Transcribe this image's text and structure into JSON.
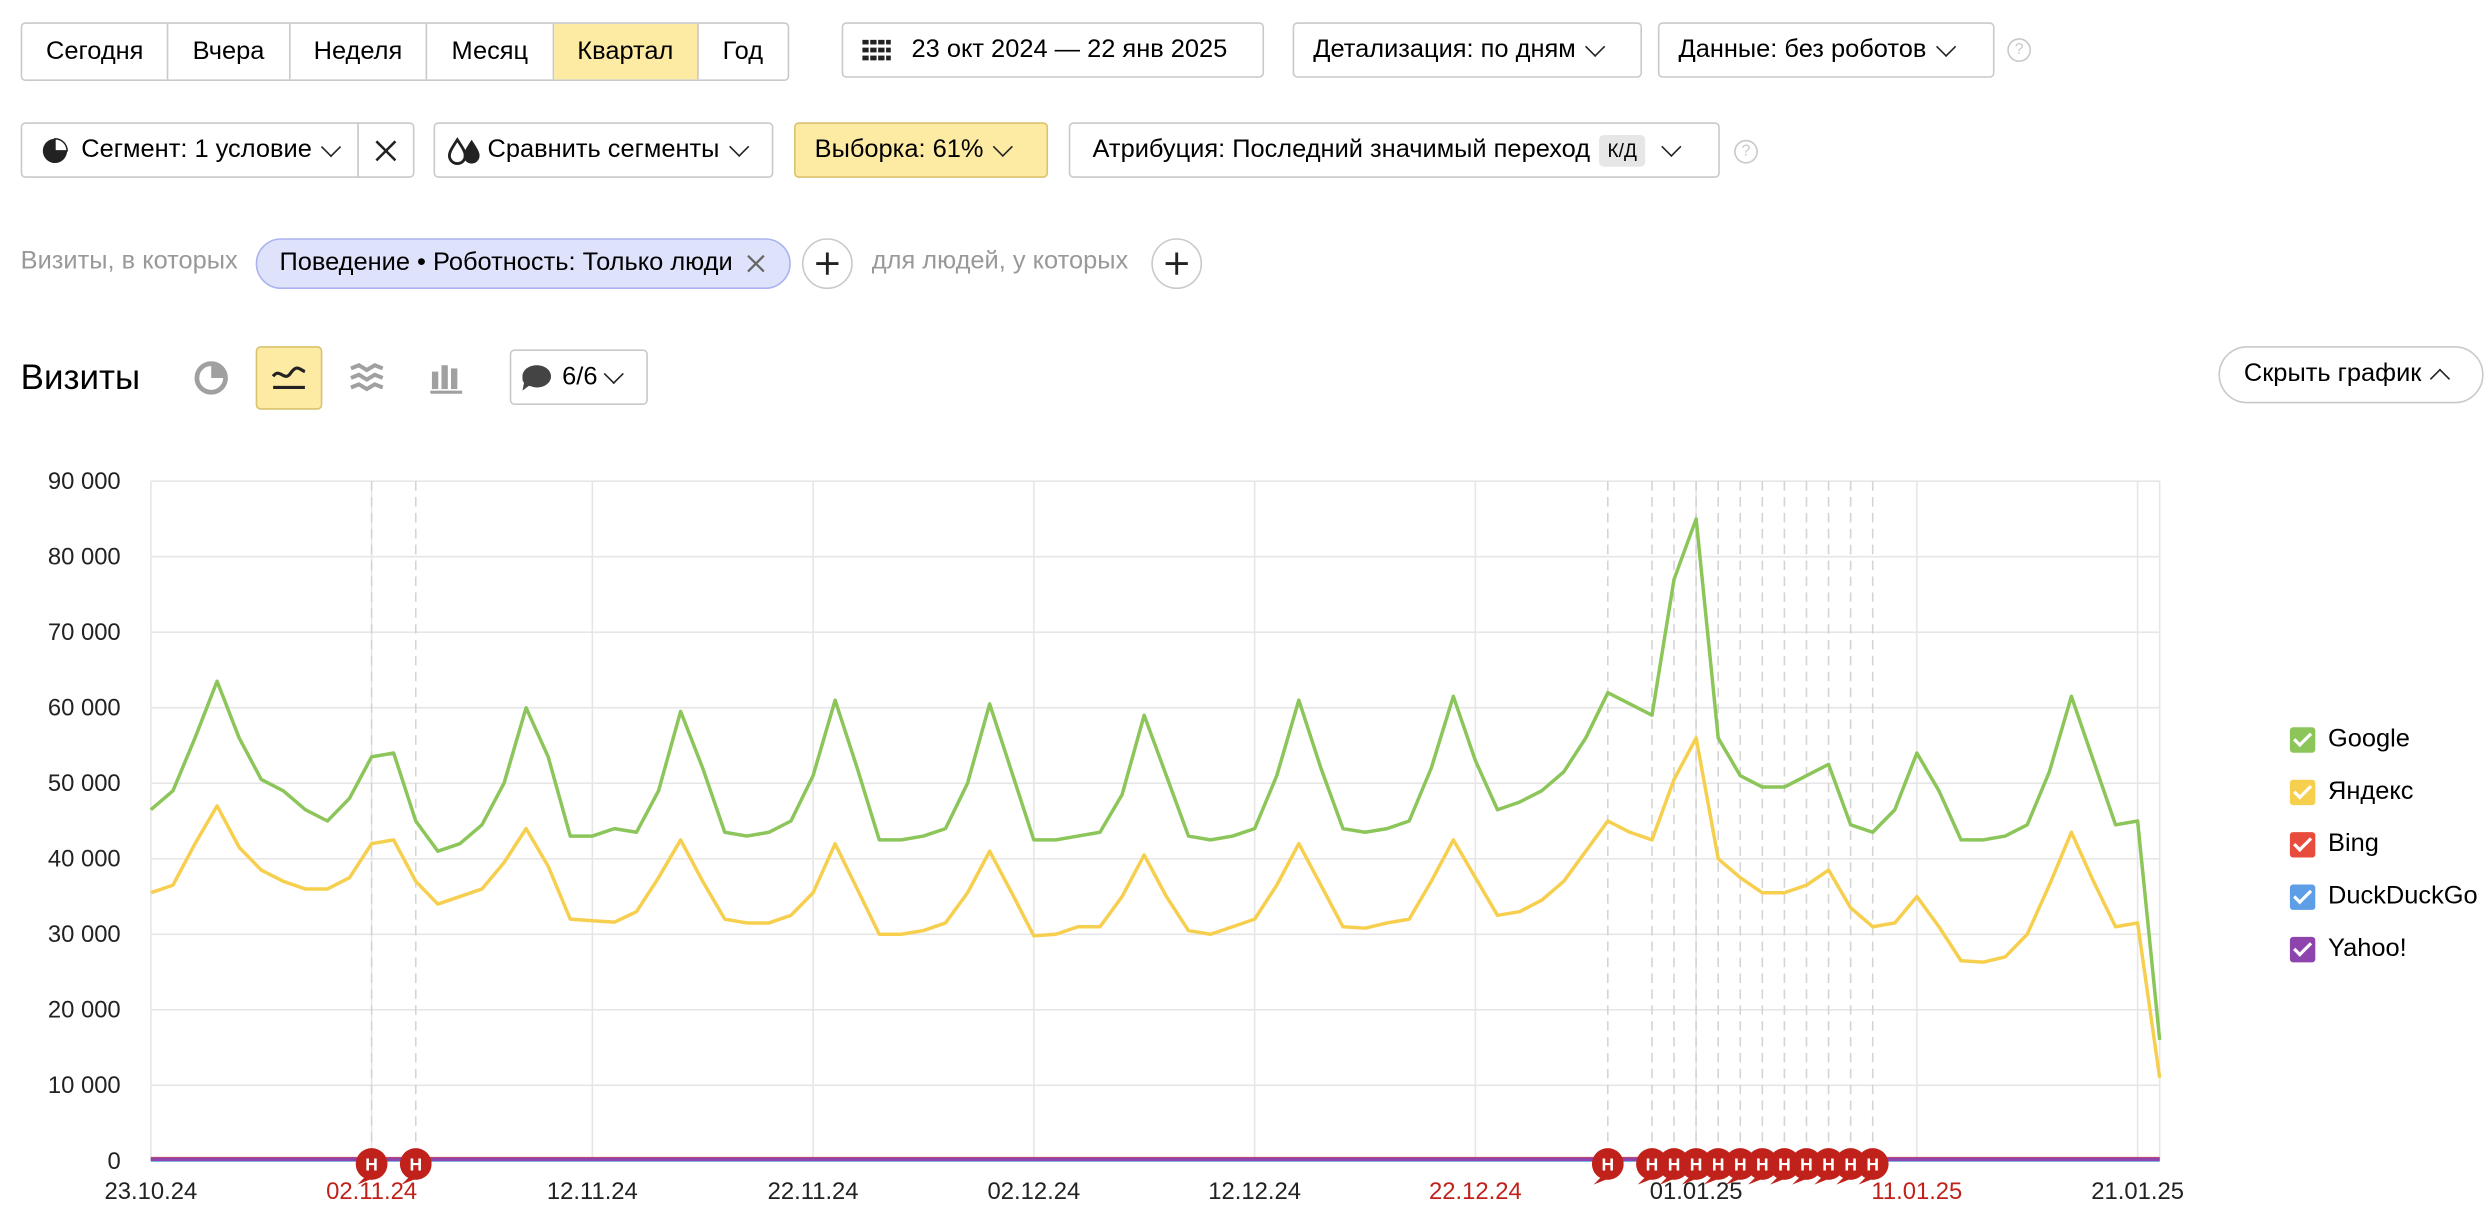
{
  "period_tabs": [
    "Сегодня",
    "Вчера",
    "Неделя",
    "Месяц",
    "Квартал",
    "Год"
  ],
  "period_active": "Квартал",
  "date_range": "23 окт 2024 — 22 янв 2025",
  "detail_label": "Детализация: по дням",
  "data_label": "Данные: без роботов",
  "help_glyph": "?",
  "segment_label": "Сегмент: 1 условие",
  "compare_label": "Сравнить сегменты",
  "sample_label": "Выборка: 61%",
  "attribution_label": "Атрибуция: Последний значимый переход",
  "attribution_badge": "К/Д",
  "filter_prefix": "Визиты, в которых",
  "filter_chip": "Поведение • Роботность: Только люди",
  "filter_people": "для людей, у которых",
  "visits_title": "Визиты",
  "annotations_count": "6/6",
  "hide_chart_label": "Скрыть график",
  "colors": {
    "accent_yellow": "#fdeaa3",
    "google": "#8cc65a",
    "yandex": "#f7cf4e",
    "bing": "#e84c3d",
    "duckduckgo": "#5d9ee6",
    "yahoo": "#8e44ad",
    "holiday": "#c0221b"
  },
  "chart_data": {
    "type": "line",
    "x_start": "2024-10-23",
    "x_end": "2025-01-22",
    "x_ticks": [
      {
        "date": "2024-10-23",
        "label": "23.10.24",
        "holiday": false
      },
      {
        "date": "2024-11-02",
        "label": "02.11.24",
        "holiday": true
      },
      {
        "date": "2024-11-12",
        "label": "12.11.24",
        "holiday": false
      },
      {
        "date": "2024-11-22",
        "label": "22.11.24",
        "holiday": false
      },
      {
        "date": "2024-12-02",
        "label": "02.12.24",
        "holiday": false
      },
      {
        "date": "2024-12-12",
        "label": "12.12.24",
        "holiday": false
      },
      {
        "date": "2024-12-22",
        "label": "22.12.24",
        "holiday": true
      },
      {
        "date": "2025-01-01",
        "label": "01.01.25",
        "holiday": false
      },
      {
        "date": "2025-01-11",
        "label": "11.01.25",
        "holiday": true
      },
      {
        "date": "2025-01-21",
        "label": "21.01.25",
        "holiday": false
      }
    ],
    "y_ticks": [
      {
        "value": 0,
        "label": "0"
      },
      {
        "value": 10000,
        "label": "10 000"
      },
      {
        "value": 20000,
        "label": "20 000"
      },
      {
        "value": 30000,
        "label": "30 000"
      },
      {
        "value": 40000,
        "label": "40 000"
      },
      {
        "value": 50000,
        "label": "50 000"
      },
      {
        "value": 60000,
        "label": "60 000"
      },
      {
        "value": 70000,
        "label": "70 000"
      },
      {
        "value": 80000,
        "label": "80 000"
      },
      {
        "value": 90000,
        "label": "90 000"
      }
    ],
    "ylim": [
      0,
      90000
    ],
    "grid": true,
    "legend_position": "right",
    "holiday_marker_label": "Н",
    "holiday_dates": [
      "2024-11-02",
      "2024-11-04",
      "2024-12-28",
      "2024-12-30",
      "2024-12-31",
      "2025-01-01",
      "2025-01-02",
      "2025-01-03",
      "2025-01-04",
      "2025-01-05",
      "2025-01-06",
      "2025-01-07",
      "2025-01-08",
      "2025-01-09"
    ],
    "series": [
      {
        "name": "Google",
        "color": "#8cc65a",
        "values": [
          46500,
          49000,
          56000,
          63500,
          56000,
          50500,
          49000,
          46500,
          45000,
          48000,
          53500,
          54000,
          45000,
          41000,
          42000,
          44500,
          50000,
          60000,
          53500,
          43000,
          43000,
          44000,
          43500,
          49000,
          59500,
          52000,
          43500,
          43000,
          43500,
          45000,
          51000,
          61000,
          52000,
          42500,
          42500,
          43000,
          44000,
          50000,
          60500,
          51500,
          42500,
          42500,
          43000,
          43500,
          48500,
          59000,
          51000,
          43000,
          42500,
          43000,
          44000,
          51000,
          61000,
          52000,
          44000,
          43500,
          44000,
          45000,
          52000,
          61500,
          53000,
          46500,
          47500,
          49000,
          51500,
          56000,
          62000,
          60500,
          59000,
          77000,
          85000,
          56000,
          51000,
          49500,
          49500,
          51000,
          52500,
          44500,
          43500,
          46500,
          54000,
          49000,
          42500,
          42500,
          43000,
          44500,
          51500,
          61500,
          53000,
          44500,
          45000,
          16000
        ]
      },
      {
        "name": "Яндекс",
        "color": "#f7cf4e",
        "values": [
          35500,
          36500,
          42000,
          47000,
          41500,
          38500,
          37000,
          36000,
          36000,
          37500,
          42000,
          42500,
          37000,
          34000,
          35000,
          36000,
          39500,
          44000,
          39000,
          32000,
          31800,
          31600,
          33000,
          37500,
          42500,
          37000,
          32000,
          31500,
          31500,
          32500,
          35500,
          42000,
          36000,
          30000,
          30000,
          30500,
          31500,
          35500,
          41000,
          35500,
          29800,
          30000,
          31000,
          31000,
          35000,
          40500,
          35000,
          30500,
          30000,
          31000,
          32000,
          36500,
          42000,
          36500,
          31000,
          30800,
          31500,
          32000,
          37000,
          42500,
          37500,
          32500,
          33000,
          34500,
          37000,
          41000,
          45000,
          43500,
          42500,
          50500,
          56000,
          40000,
          37500,
          35500,
          35500,
          36500,
          38500,
          33500,
          31000,
          31500,
          35000,
          31000,
          26500,
          26300,
          27000,
          30000,
          36500,
          43500,
          37000,
          31000,
          31500,
          11000
        ]
      },
      {
        "name": "Bing",
        "color": "#e84c3d",
        "values": [
          300,
          300,
          300
        ]
      },
      {
        "name": "DuckDuckGo",
        "color": "#5d9ee6",
        "values": [
          100,
          100,
          100
        ]
      },
      {
        "name": "Yahoo!",
        "color": "#8e44ad",
        "values": [
          200,
          200,
          200
        ]
      }
    ]
  }
}
